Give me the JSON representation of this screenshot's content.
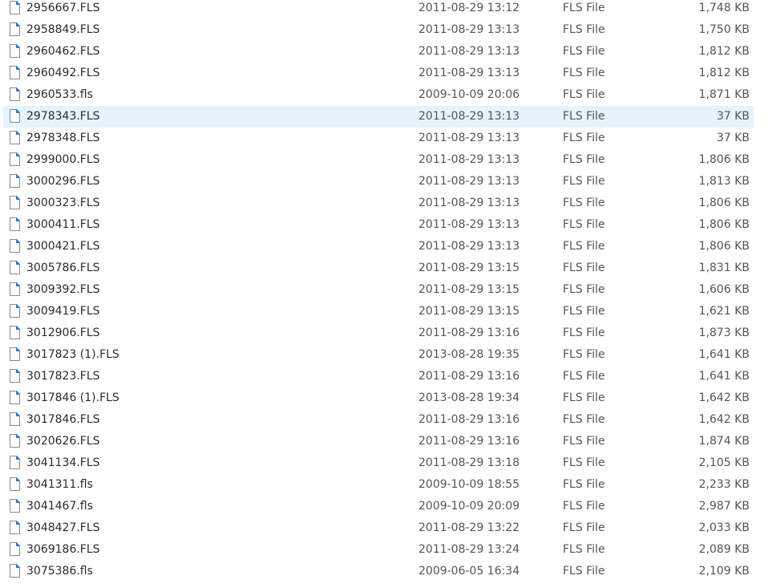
{
  "files": [
    {
      "name": "2956667.FLS",
      "date": "2011-08-29 13:12",
      "type": "FLS File",
      "size": "1,748 KB",
      "icon": "file-icon",
      "selected": false
    },
    {
      "name": "2958849.FLS",
      "date": "2011-08-29 13:13",
      "type": "FLS File",
      "size": "1,750 KB",
      "icon": "file-icon",
      "selected": false
    },
    {
      "name": "2960462.FLS",
      "date": "2011-08-29 13:13",
      "type": "FLS File",
      "size": "1,812 KB",
      "icon": "file-icon",
      "selected": false
    },
    {
      "name": "2960492.FLS",
      "date": "2011-08-29 13:13",
      "type": "FLS File",
      "size": "1,812 KB",
      "icon": "file-icon",
      "selected": false
    },
    {
      "name": "2960533.fls",
      "date": "2009-10-09 20:06",
      "type": "FLS File",
      "size": "1,871 KB",
      "icon": "file-icon",
      "selected": false
    },
    {
      "name": "2978343.FLS",
      "date": "2011-08-29 13:13",
      "type": "FLS File",
      "size": "37 KB",
      "icon": "file-icon",
      "selected": true
    },
    {
      "name": "2978348.FLS",
      "date": "2011-08-29 13:13",
      "type": "FLS File",
      "size": "37 KB",
      "icon": "file-icon",
      "selected": false
    },
    {
      "name": "2999000.FLS",
      "date": "2011-08-29 13:13",
      "type": "FLS File",
      "size": "1,806 KB",
      "icon": "file-icon",
      "selected": false
    },
    {
      "name": "3000296.FLS",
      "date": "2011-08-29 13:13",
      "type": "FLS File",
      "size": "1,813 KB",
      "icon": "file-icon",
      "selected": false
    },
    {
      "name": "3000323.FLS",
      "date": "2011-08-29 13:13",
      "type": "FLS File",
      "size": "1,806 KB",
      "icon": "file-icon",
      "selected": false
    },
    {
      "name": "3000411.FLS",
      "date": "2011-08-29 13:13",
      "type": "FLS File",
      "size": "1,806 KB",
      "icon": "file-icon",
      "selected": false
    },
    {
      "name": "3000421.FLS",
      "date": "2011-08-29 13:13",
      "type": "FLS File",
      "size": "1,806 KB",
      "icon": "file-icon",
      "selected": false
    },
    {
      "name": "3005786.FLS",
      "date": "2011-08-29 13:15",
      "type": "FLS File",
      "size": "1,831 KB",
      "icon": "file-icon",
      "selected": false
    },
    {
      "name": "3009392.FLS",
      "date": "2011-08-29 13:15",
      "type": "FLS File",
      "size": "1,606 KB",
      "icon": "file-icon",
      "selected": false
    },
    {
      "name": "3009419.FLS",
      "date": "2011-08-29 13:15",
      "type": "FLS File",
      "size": "1,621 KB",
      "icon": "file-icon",
      "selected": false
    },
    {
      "name": "3012906.FLS",
      "date": "2011-08-29 13:16",
      "type": "FLS File",
      "size": "1,873 KB",
      "icon": "file-icon",
      "selected": false
    },
    {
      "name": "3017823 (1).FLS",
      "date": "2013-08-28 19:35",
      "type": "FLS File",
      "size": "1,641 KB",
      "icon": "file-icon",
      "selected": false
    },
    {
      "name": "3017823.FLS",
      "date": "2011-08-29 13:16",
      "type": "FLS File",
      "size": "1,641 KB",
      "icon": "file-icon",
      "selected": false
    },
    {
      "name": "3017846 (1).FLS",
      "date": "2013-08-28 19:34",
      "type": "FLS File",
      "size": "1,642 KB",
      "icon": "file-icon",
      "selected": false
    },
    {
      "name": "3017846.FLS",
      "date": "2011-08-29 13:16",
      "type": "FLS File",
      "size": "1,642 KB",
      "icon": "file-icon",
      "selected": false
    },
    {
      "name": "3020626.FLS",
      "date": "2011-08-29 13:16",
      "type": "FLS File",
      "size": "1,874 KB",
      "icon": "file-icon",
      "selected": false
    },
    {
      "name": "3041134.FLS",
      "date": "2011-08-29 13:18",
      "type": "FLS File",
      "size": "2,105 KB",
      "icon": "file-icon",
      "selected": false
    },
    {
      "name": "3041311.fls",
      "date": "2009-10-09 18:55",
      "type": "FLS File",
      "size": "2,233 KB",
      "icon": "file-icon",
      "selected": false
    },
    {
      "name": "3041467.fls",
      "date": "2009-10-09 20:09",
      "type": "FLS File",
      "size": "2,987 KB",
      "icon": "file-icon",
      "selected": false
    },
    {
      "name": "3048427.FLS",
      "date": "2011-08-29 13:22",
      "type": "FLS File",
      "size": "2,033 KB",
      "icon": "file-icon",
      "selected": false
    },
    {
      "name": "3069186.FLS",
      "date": "2011-08-29 13:24",
      "type": "FLS File",
      "size": "2,089 KB",
      "icon": "file-icon",
      "selected": false
    },
    {
      "name": "3075386.fls",
      "date": "2009-06-05 16:34",
      "type": "FLS File",
      "size": "2,109 KB",
      "icon": "file-icon",
      "selected": false
    }
  ],
  "colors": {
    "selected_row_bg": "#e5f3fb",
    "icon_outline": "#8a8a8a",
    "icon_accent": "#2b7cd3",
    "text": "#2b2b2b",
    "secondary_text": "#555555"
  }
}
